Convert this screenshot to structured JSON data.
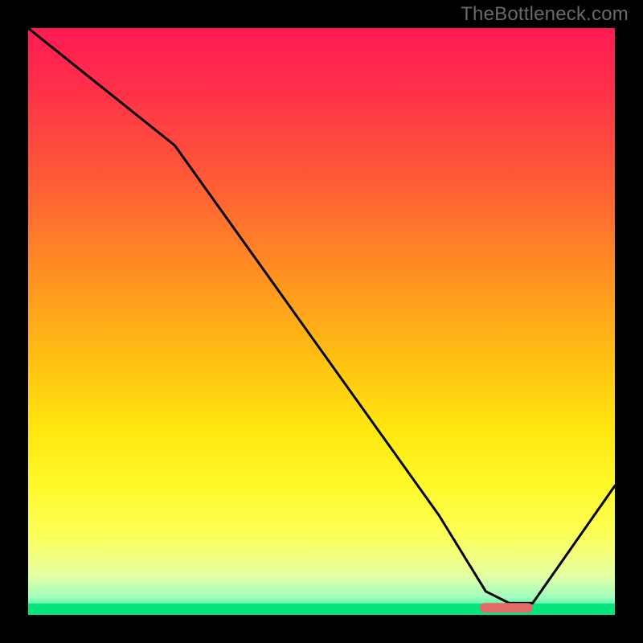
{
  "watermark": "TheBottleneck.com",
  "chart_data": {
    "type": "line",
    "title": "",
    "xlabel": "",
    "ylabel": "",
    "xlim": [
      0,
      100
    ],
    "ylim": [
      0,
      100
    ],
    "legend": false,
    "grid": false,
    "background_gradient": {
      "direction": "vertical",
      "stops": [
        {
          "pos": 0,
          "color": "#ff1a52",
          "meaning": "high"
        },
        {
          "pos": 50,
          "color": "#ffbb14",
          "meaning": "mid"
        },
        {
          "pos": 100,
          "color": "#00e67a",
          "meaning": "low/optimal"
        }
      ]
    },
    "series": [
      {
        "name": "curve",
        "color": "#000000",
        "x": [
          0,
          10,
          25,
          40,
          55,
          70,
          78,
          82,
          86,
          100
        ],
        "values": [
          100,
          92,
          80,
          59,
          38,
          17,
          4,
          2,
          2,
          22
        ]
      }
    ],
    "marker": {
      "name": "optimal-range",
      "color": "#e46a6a",
      "x_start": 77,
      "x_end": 86,
      "y": 1.2
    }
  }
}
